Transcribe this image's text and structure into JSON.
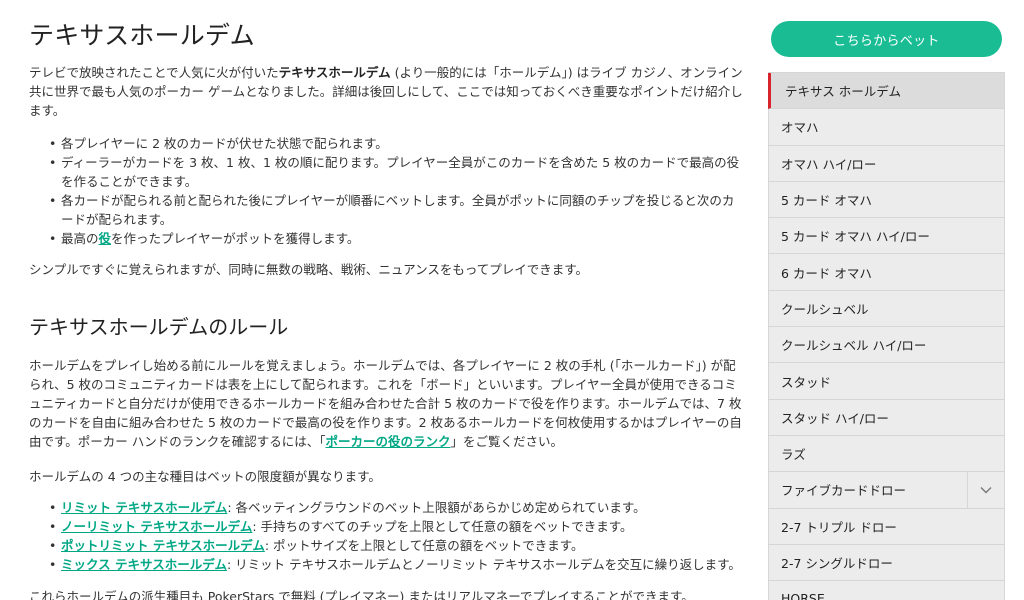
{
  "main": {
    "title": "テキサスホールデム",
    "intro": {
      "pre": "テレビで放映されたことで人気に火が付いた",
      "strong": "テキサスホールデム",
      "post": " (より一般的には「ホールデム」) はライブ カジノ、オンライン共に世界で最も人気のポーカー ゲームとなりました。詳細は後回しにして、ここでは知っておくべき重要なポイントだけ紹介します。"
    },
    "bullets": [
      "各プレイヤーに 2 枚のカードが伏せた状態で配られます。",
      "ディーラーがカードを 3 枚、1 枚、1 枚の順に配ります。プレイヤー全員がこのカードを含めた 5 枚のカードで最高の役を作ることができます。",
      "各カードが配られる前と配られた後にプレイヤーが順番にベットします。全員がポットに同額のチップを投じると次のカードが配られます。"
    ],
    "bullet4": {
      "pre": "最高の",
      "link": "役",
      "post": "を作ったプレイヤーがポットを獲得します。"
    },
    "summary": "シンプルですぐに覚えられますが、同時に無数の戦略、戦術、ニュアンスをもってプレイできます。",
    "rules_heading": "テキサスホールデムのルール",
    "rules_para": {
      "pre": "ホールデムをプレイし始める前にルールを覚えましょう。ホールデムでは、各プレイヤーに 2 枚の手札 (「ホールカード」) が配られ、5 枚のコミュニティカードは表を上にして配られます。これを「ボード」といいます。プレイヤー全員が使用できるコミュニティカードと自分だけが使用できるホールカードを組み合わせた合計 5 枚のカードで役を作ります。ホールデムでは、7 枚のカードを自由に組み合わせた 5 枚のカードで最高の役を作ります。2 枚あるホールカードを何枚使用するかはプレイヤーの自由です。ポーカー ハンドのランクを確認するには、「",
      "link": "ポーカーの役のランク",
      "post": "」をご覧ください。"
    },
    "variants_intro": "ホールデムの 4 つの主な種目はベットの限度額が異なります。",
    "variants": [
      {
        "link": "リミット テキサスホールデム",
        "text": ": 各ベッティングラウンドのベット上限額があらかじめ定められています。"
      },
      {
        "link": "ノーリミット テキサスホールデム",
        "text": ": 手持ちのすべてのチップを上限として任意の額をベットできます。"
      },
      {
        "link": "ポットリミット テキサスホールデム",
        "text": ": ポットサイズを上限として任意の額をベットできます。"
      },
      {
        "link": "ミックス テキサスホールデム",
        "text": ": リミット テキサスホールデムとノーリミット テキサスホールデムを交互に繰り返します。"
      }
    ],
    "bottom": "これらホールデムの派生種目も PokerStars で無料 (プレイマネー) またはリアルマネーでプレイすることができます。"
  },
  "sidebar": {
    "bet_button": "こちらからベット",
    "items": [
      "テキサス ホールデム",
      "オマハ",
      "オマハ ハイ/ロー",
      "5 カード オマハ",
      "5 カード オマハ ハイ/ロー",
      "6 カード オマハ",
      "クールシュベル",
      "クールシュベル ハイ/ロー",
      "スタッド",
      "スタッド ハイ/ロー",
      "ラズ",
      "ファイブカードドロー",
      "2-7 トリプル ドロー",
      "2-7 シングルドロー",
      "HORSE"
    ],
    "active_index": 0,
    "chevron_icon": "chevron-down-icon"
  },
  "colors": {
    "accent": "#1abc94",
    "link": "#00a785",
    "active_marker": "#d9232d",
    "menu_bg": "#ececec"
  }
}
